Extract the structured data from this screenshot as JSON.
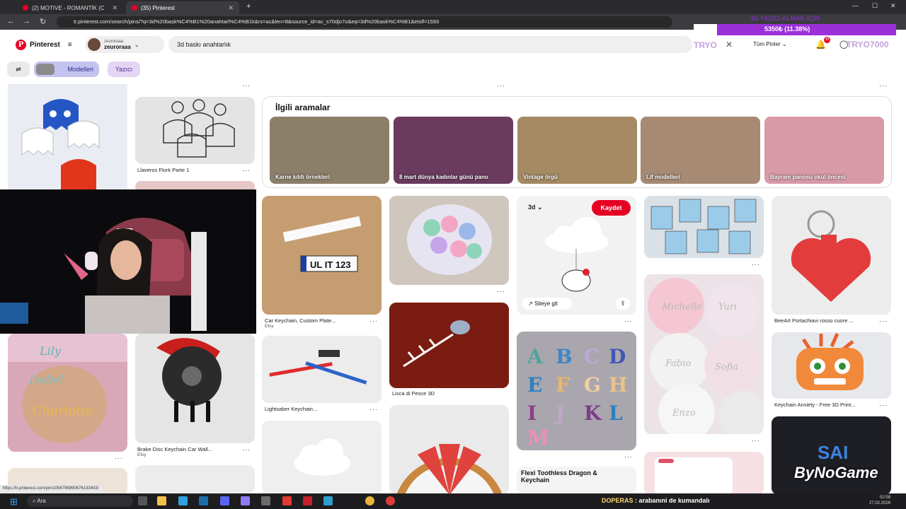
{
  "browser": {
    "tabs": [
      {
        "label": "(2) MOTIVE - ROMANTİK (C",
        "active": false
      },
      {
        "label": "(35) Pinterest",
        "active": true
      }
    ],
    "url": "tr.pinterest.com/search/pins/?q=3d%20bask%C4%B1%20anahtarl%C4%B1k&rs=ac&len=8&source_id=ac_s70djo7o&eq=3d%20bask%C4%B1&etslf=1593"
  },
  "header": {
    "logo": "Pinterest",
    "account_sub": "zeuroraaa",
    "account_name": "zeuroraaa",
    "search_value": "3d baskı anahtarlık",
    "all_pins": "Tüm Pinler",
    "notif_count": "35"
  },
  "overlay": {
    "title": "3D YAZICI ALMAK İÇİN",
    "value": "5350₺ (11.38%)",
    "tag": "TRYO",
    "tag2": "TRYO7000",
    "ticker_name": "DOPERAS",
    "ticker_msg": ": arabanıni de kumandalı",
    "watermark": "ByNoGame"
  },
  "filters": [
    {
      "label": "Modelleri",
      "selected": true
    },
    {
      "label": "Yazıcı",
      "selected": false
    }
  ],
  "related": {
    "heading": "İlgili aramalar",
    "items": [
      {
        "label": "Karne kılıfı örnekleri",
        "color": "#8c7f6a"
      },
      {
        "label": "8 mart dünya kadınlar günü pano",
        "color": "#6a3b5e"
      },
      {
        "label": "Vintage örgü",
        "color": "#a58a63"
      },
      {
        "label": "Lif modelleri",
        "color": "#a68a74"
      },
      {
        "label": "Bayram panosu okul öncesi",
        "color": "#d99aa8"
      }
    ]
  },
  "pins": {
    "flork": "Llaveros Flork Parte 1",
    "car": "Car Keychain, Custom Plate...",
    "car_src": "Etsy",
    "brake": "Brake Disc Keychain Car Wall...",
    "brake_src": "Etsy",
    "saber": "Lightsaber Keychain...",
    "fish": "Lisca di Pesce 3D",
    "heart": "BeeArt Portachiavi rosso cuore ...",
    "anxiety": "Keychain Anxiety - Free 3D Print...",
    "dragon": "Flexi Toothless Dragon & Keychain",
    "plate_text": "UL IT 123",
    "hover_board": "3d",
    "save_btn": "Kaydet",
    "site_btn": "Siteye git"
  },
  "statusbar": "https://tr.pinterest.com/pin/1094796990676133403/",
  "taskbar": {
    "search": "Ara",
    "time": "02:58",
    "date": "27.02.2026"
  }
}
